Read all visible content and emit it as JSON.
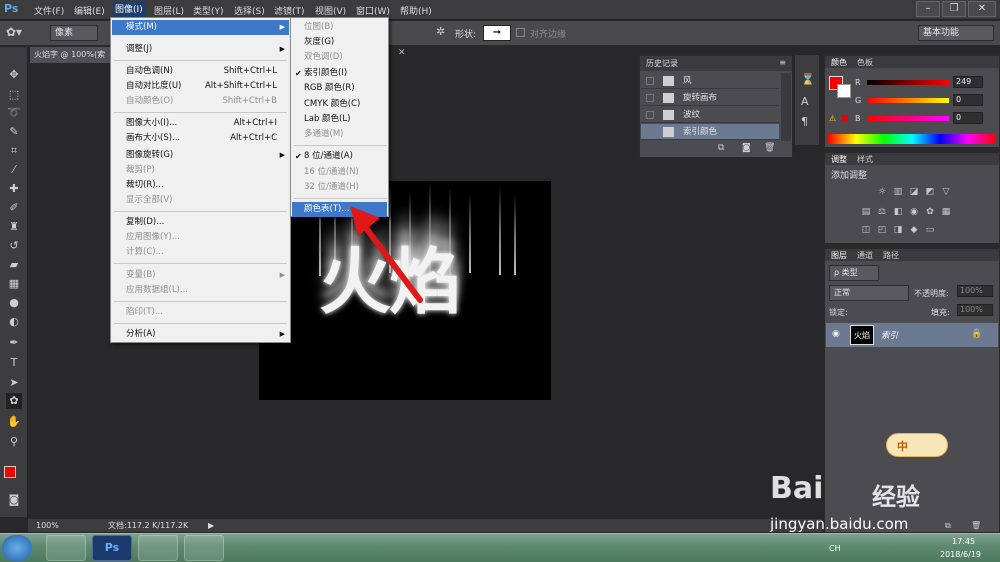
{
  "menubar": {
    "logo": "Ps",
    "items": [
      "文件(F)",
      "编辑(E)",
      "图像(I)",
      "图层(L)",
      "类型(Y)",
      "选择(S)",
      "滤镜(T)",
      "视图(V)",
      "窗口(W)",
      "帮助(H)"
    ],
    "active_index": 2
  },
  "optbar": {
    "mode_value": "像素",
    "shape_label": "形状:",
    "align_edges_label": "对齐边缘",
    "workspace_value": "基本功能"
  },
  "doctab": {
    "label": "火焰字 @ 100%(索"
  },
  "image_menu": {
    "rows": [
      {
        "label": "模式(M)",
        "shortcut": "",
        "submenu": true,
        "disabled": false,
        "highlighted": true
      },
      {
        "label": "调整(J)",
        "shortcut": "",
        "submenu": true,
        "disabled": false
      },
      {
        "label": "自动色调(N)",
        "shortcut": "Shift+Ctrl+L",
        "disabled": false
      },
      {
        "label": "自动对比度(U)",
        "shortcut": "Alt+Shift+Ctrl+L",
        "disabled": false
      },
      {
        "label": "自动颜色(O)",
        "shortcut": "Shift+Ctrl+B",
        "disabled": true
      },
      {
        "label": "图像大小(I)...",
        "shortcut": "Alt+Ctrl+I",
        "disabled": false
      },
      {
        "label": "画布大小(S)...",
        "shortcut": "Alt+Ctrl+C",
        "disabled": false
      },
      {
        "label": "图像旋转(G)",
        "shortcut": "",
        "submenu": true,
        "disabled": false
      },
      {
        "label": "裁剪(P)",
        "shortcut": "",
        "disabled": true
      },
      {
        "label": "裁切(R)...",
        "shortcut": "",
        "disabled": false
      },
      {
        "label": "显示全部(V)",
        "shortcut": "",
        "disabled": true
      },
      {
        "label": "复制(D)...",
        "shortcut": "",
        "disabled": false
      },
      {
        "label": "应用图像(Y)...",
        "shortcut": "",
        "disabled": true
      },
      {
        "label": "计算(C)...",
        "shortcut": "",
        "disabled": true
      },
      {
        "label": "变量(B)",
        "shortcut": "",
        "submenu": true,
        "disabled": true
      },
      {
        "label": "应用数据组(L)...",
        "shortcut": "",
        "disabled": true
      },
      {
        "label": "陷印(T)...",
        "shortcut": "",
        "disabled": true
      },
      {
        "label": "分析(A)",
        "shortcut": "",
        "submenu": true,
        "disabled": false
      }
    ]
  },
  "mode_submenu": {
    "rows": [
      {
        "label": "位图(B)",
        "disabled": true,
        "checked": false
      },
      {
        "label": "灰度(G)",
        "disabled": false,
        "checked": false
      },
      {
        "label": "双色调(D)",
        "disabled": true,
        "checked": false
      },
      {
        "label": "索引颜色(I)",
        "disabled": false,
        "checked": true
      },
      {
        "label": "RGB 颜色(R)",
        "disabled": false,
        "checked": false
      },
      {
        "label": "CMYK 颜色(C)",
        "disabled": false,
        "checked": false
      },
      {
        "label": "Lab 颜色(L)",
        "disabled": false,
        "checked": false
      },
      {
        "label": "多通道(M)",
        "disabled": true,
        "checked": false
      },
      {
        "label": "8 位/通道(A)",
        "disabled": false,
        "checked": true
      },
      {
        "label": "16 位/通道(N)",
        "disabled": true,
        "checked": false
      },
      {
        "label": "32 位/通道(H)",
        "disabled": true,
        "checked": false
      },
      {
        "label": "颜色表(T)...",
        "disabled": false,
        "checked": false,
        "highlighted": true
      }
    ]
  },
  "canvas": {
    "text": "火焰"
  },
  "history": {
    "title": "历史记录",
    "items": [
      "风",
      "旋转画布",
      "波纹",
      "索引颜色"
    ],
    "selected_index": 3
  },
  "color_panel": {
    "tabs": [
      "颜色",
      "色板"
    ],
    "r_label": "R",
    "r_value": "249",
    "g_label": "G",
    "g_value": "0",
    "b_label": "B",
    "b_value": "0",
    "fg_color": "#f90000"
  },
  "adjust_panel": {
    "tabs": [
      "调整",
      "样式"
    ],
    "title": "添加调整"
  },
  "layers_panel": {
    "tabs": [
      "图层",
      "通道",
      "路径"
    ],
    "kind_value": "ρ 类型",
    "blend_value": "正常",
    "opacity_label": "不透明度:",
    "opacity_value": "100%",
    "lock_label": "锁定:",
    "fill_label": "填充:",
    "fill_value": "100%",
    "layer_thumb_text": "火焰",
    "layer_name": "索引"
  },
  "statusbar": {
    "zoom": "100%",
    "doc_info": "文档:117.2 K/117.2K"
  },
  "taskbar": {
    "time": "17:45",
    "date": "2018/6/19",
    "clock_icons": "CH"
  },
  "chat_widget": {
    "text": "中"
  },
  "watermark": {
    "brand": "Bai",
    "brand2": "经验",
    "url": "jingyan.baidu.com"
  }
}
